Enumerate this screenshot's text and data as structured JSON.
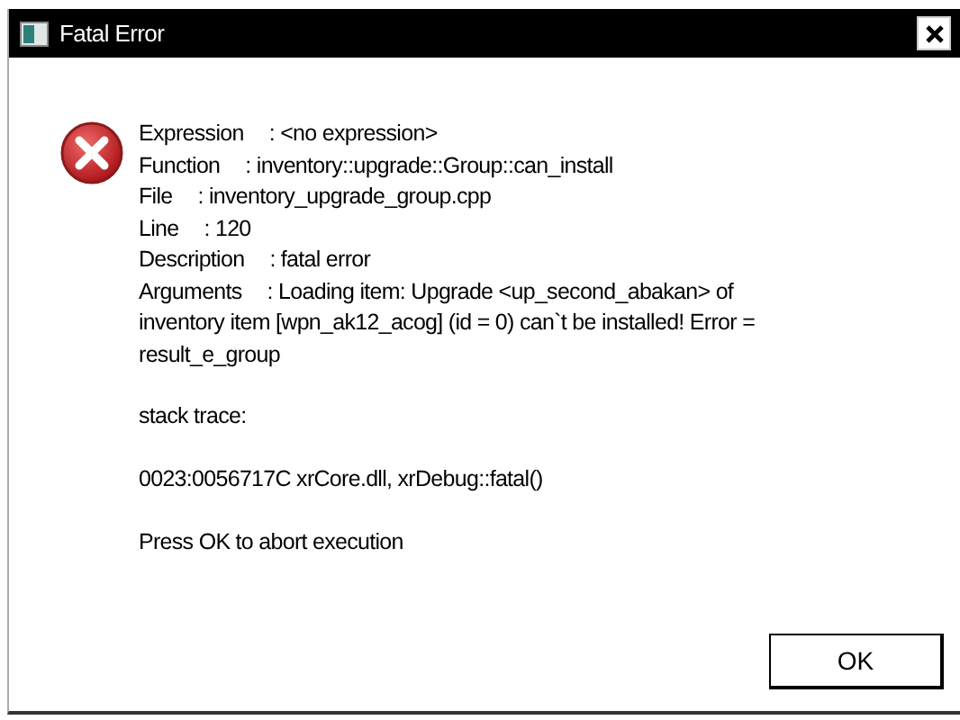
{
  "window": {
    "title": "Fatal Error"
  },
  "fields": [
    {
      "label": "Expression",
      "value": ": <no expression>"
    },
    {
      "label": "Function",
      "value": ": inventory::upgrade::Group::can_install"
    },
    {
      "label": "File",
      "value": ": inventory_upgrade_group.cpp"
    },
    {
      "label": "Line",
      "value": ": 120"
    },
    {
      "label": "Description",
      "value": ": fatal error"
    },
    {
      "label": "Arguments",
      "value": ": Loading item: Upgrade <up_second_abakan> of inventory item [wpn_ak12_acog] (id = 0) can`t be installed! Error = result_e_group"
    }
  ],
  "stack_heading": "stack trace:",
  "stack_lines": [
    "0023:0056717C xrCore.dll, xrDebug::fatal()"
  ],
  "prompt": "Press OK to abort execution",
  "buttons": [
    "OK"
  ]
}
